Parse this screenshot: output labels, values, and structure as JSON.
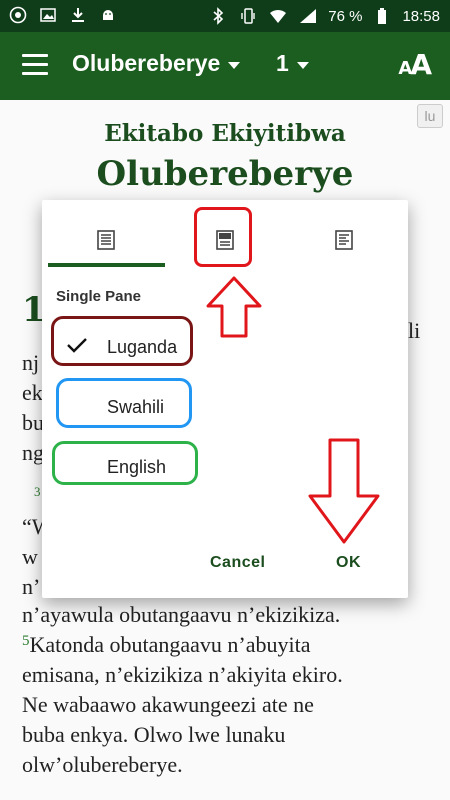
{
  "status_bar": {
    "battery": "76 %",
    "time": "18:58",
    "left_icons": [
      "app-icon",
      "image-icon",
      "download-icon",
      "android-icon"
    ],
    "right_icons": [
      "bluetooth-icon",
      "vibrate-icon",
      "wifi-icon",
      "signal-icon",
      "battery-icon"
    ]
  },
  "app_bar": {
    "book": "Olubereberye",
    "chapter": "1",
    "font_size_label_small": "A",
    "font_size_label_large": "A"
  },
  "content": {
    "language_chip": "lu",
    "book_subtitle": "Ekitabo Ekiyitibwa",
    "book_title": "Olubereberye",
    "chapter_number": "1",
    "frag_right": "li",
    "frag_lines": [
      "nj",
      "ek",
      "bu",
      "ng"
    ],
    "frag_verse": "3",
    "frag_quote": "“W",
    "frag_w": "w",
    "frag_n": "n’",
    "line1": "n’ayawula obutangaavu n’ekizikiza.",
    "verse5": "5",
    "line2": "Katonda obutangaavu n’abuyita",
    "line3": "emisana, n’ekizikiza n’akiyita ekiro.",
    "line4": "Ne wabaawo akawungeezi ate ne",
    "line5": "buba enkya. Olwo lwe lunaku",
    "line6": "olw’olubereberye."
  },
  "dialog": {
    "tabs": [
      {
        "name": "single-pane",
        "selected": true
      },
      {
        "name": "split-pane",
        "selected": false
      },
      {
        "name": "parallel-pane",
        "selected": false
      }
    ],
    "section_label": "Single Pane",
    "languages": [
      {
        "label": "Luganda",
        "checked": true
      },
      {
        "label": "Swahili",
        "checked": false
      },
      {
        "label": "English",
        "checked": false
      }
    ],
    "cancel_label": "Cancel",
    "ok_label": "OK"
  },
  "colors": {
    "app_bar": "#1b5e20",
    "status_bar": "#0f3d1a",
    "title_text": "#1b4d1e",
    "annotation_red": "#e0161b",
    "annotation_maroon": "#7a1515",
    "annotation_blue": "#2196f3",
    "annotation_green": "#2db24a"
  }
}
